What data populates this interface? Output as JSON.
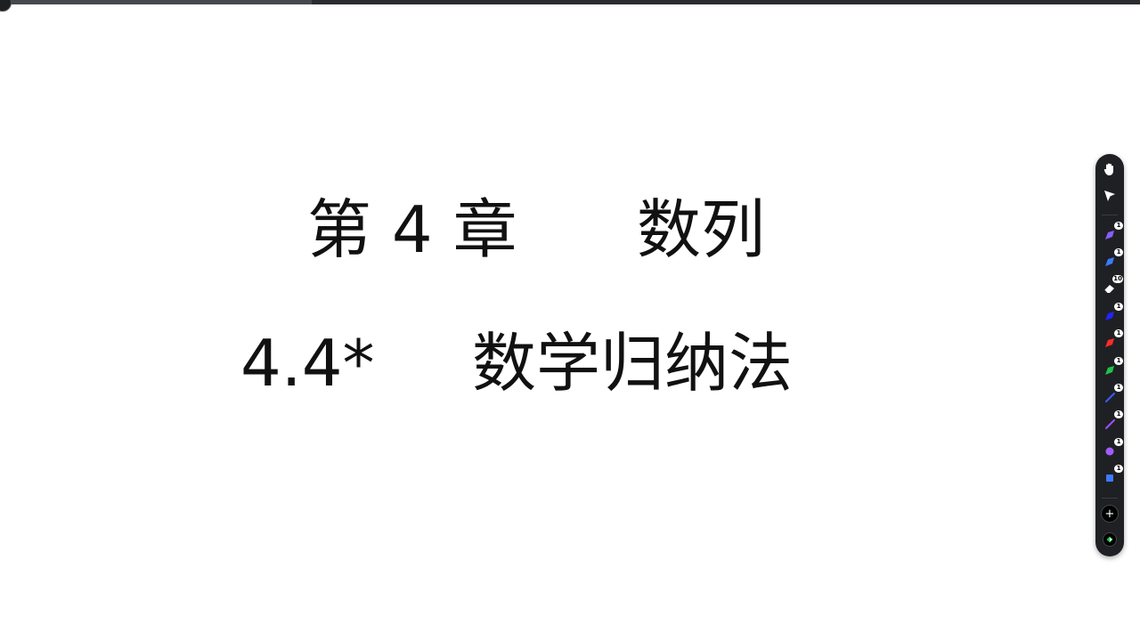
{
  "top_bar": {
    "progress_fraction": 0.27,
    "track_color": "#2a2c2f",
    "fill_color": "#45484d"
  },
  "slide": {
    "title_chapter": "第 4 章",
    "title_topic": "数列",
    "subtitle_number": "4.4*",
    "subtitle_topic": "数学归纳法"
  },
  "toolbar": {
    "tools": [
      {
        "name": "hand-icon",
        "label": "",
        "badge": ""
      },
      {
        "name": "pointer-icon",
        "label": "",
        "badge": ""
      },
      {
        "name": "pen-purple-icon",
        "color": "#8a5cff",
        "badge": "1"
      },
      {
        "name": "pen-blue-icon",
        "color": "#3b7bff",
        "badge": "1"
      },
      {
        "name": "eraser-icon",
        "color": "#ffffff",
        "badge": "10"
      },
      {
        "name": "pen-darkblue-icon",
        "color": "#2323ff",
        "badge": "1"
      },
      {
        "name": "pen-red-icon",
        "color": "#ff2a2a",
        "badge": "1"
      },
      {
        "name": "pen-green-icon",
        "color": "#1fc24a",
        "badge": "1"
      },
      {
        "name": "line-blue-icon",
        "color": "#3b5bff",
        "badge": "1"
      },
      {
        "name": "line-purple-icon",
        "color": "#9b4dff",
        "badge": "1"
      },
      {
        "name": "circle-purple-icon",
        "color": "#a25cff",
        "badge": "1"
      },
      {
        "name": "square-blue-icon",
        "color": "#3b7bff",
        "badge": "1"
      }
    ],
    "add_label": "+",
    "accent_color": "#1fc24a"
  }
}
